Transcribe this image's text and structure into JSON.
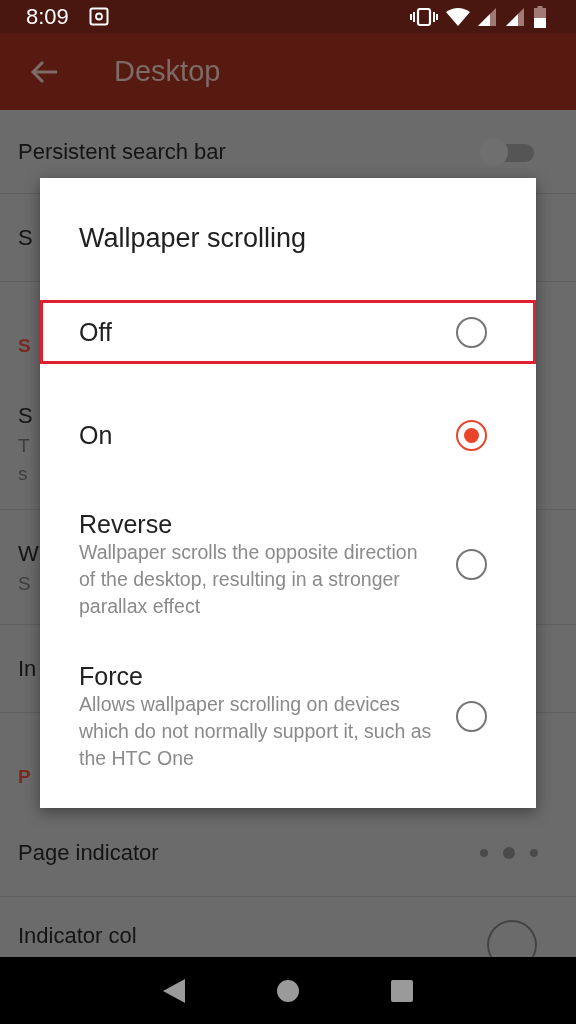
{
  "status_bar": {
    "time": "8:09"
  },
  "app_bar": {
    "title": "Desktop"
  },
  "settings": [
    {
      "kind": "switch",
      "label": "Persistent search bar",
      "on": false
    },
    {
      "kind": "item",
      "label": "S"
    },
    {
      "kind": "header",
      "label": "S"
    },
    {
      "kind": "item",
      "label": "S",
      "summary_lines": [
        "T",
        "s"
      ]
    },
    {
      "kind": "item",
      "label": "W",
      "summary_lines": [
        "S"
      ]
    },
    {
      "kind": "item",
      "label": "In"
    },
    {
      "kind": "header",
      "label": "P"
    },
    {
      "kind": "dots",
      "label": "Page indicator"
    },
    {
      "kind": "circle",
      "label": "Indicator col"
    }
  ],
  "dialog": {
    "title": "Wallpaper scrolling",
    "options": [
      {
        "label": "Off",
        "selected": false,
        "highlighted": true
      },
      {
        "label": "On",
        "selected": true,
        "highlighted": false
      },
      {
        "label": "Reverse",
        "summary": "Wallpaper scrolls the opposite direction of the desktop, resulting in a stronger parallax effect",
        "selected": false,
        "highlighted": false
      },
      {
        "label": "Force",
        "summary": "Allows wallpaper scrolling on devices which do not normally support it, such as the HTC One",
        "selected": false,
        "highlighted": false
      }
    ]
  }
}
